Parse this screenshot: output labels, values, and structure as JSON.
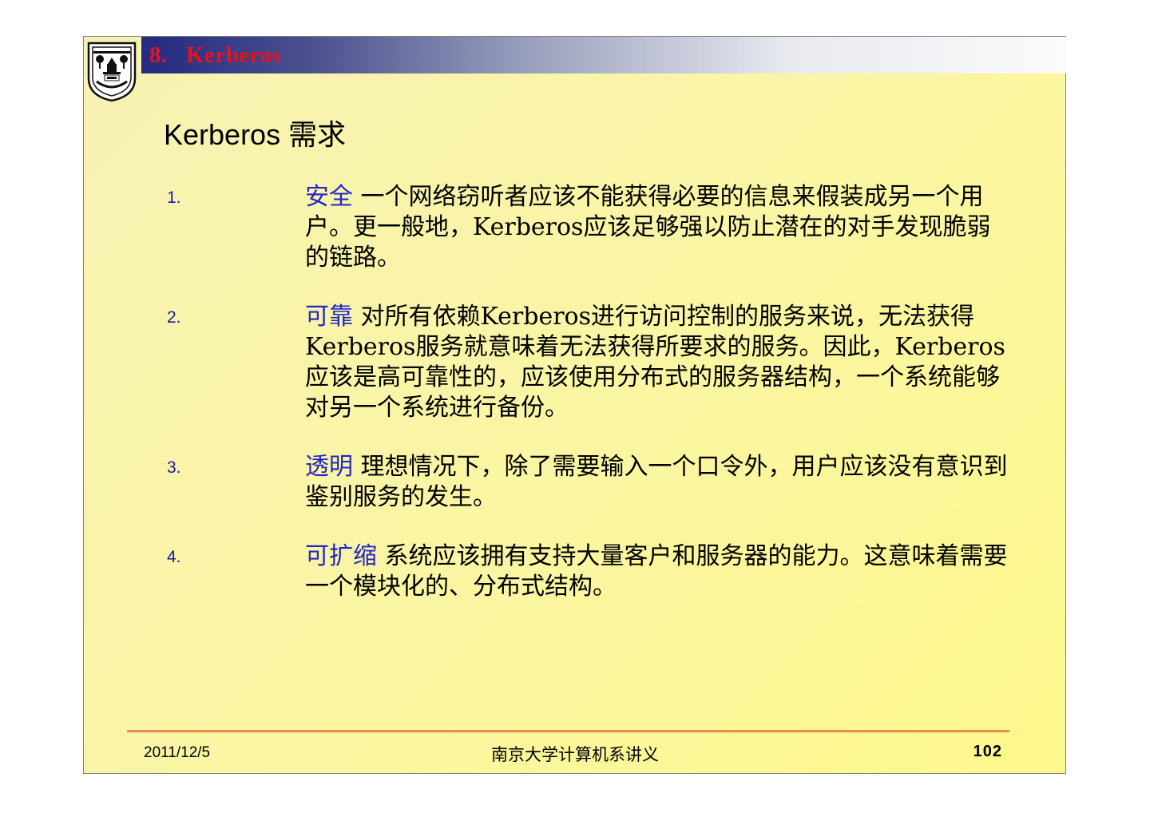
{
  "header": {
    "title": "8.   Kerberos"
  },
  "logo": {
    "icon": "university-seal-icon",
    "year": "1902",
    "text": "NANJING UNIVERSITY"
  },
  "slide": {
    "title": "Kerberos 需求"
  },
  "items": [
    {
      "number": "1.",
      "keyword": "安全",
      "text": " 一个网络窃听者应该不能获得必要的信息来假装成另一个用户。更一般地，Kerberos应该足够强以防止潜在的对手发现脆弱的链路。"
    },
    {
      "number": "2.",
      "keyword": "可靠",
      "text": " 对所有依赖Kerberos进行访问控制的服务来说，无法获得Kerberos服务就意味着无法获得所要求的服务。因此，Kerberos应该是高可靠性的，应该使用分布式的服务器结构，一个系统能够对另一个系统进行备份。"
    },
    {
      "number": "3.",
      "keyword": "透明",
      "text": " 理想情况下，除了需要输入一个口令外，用户应该没有意识到鉴别服务的发生。"
    },
    {
      "number": "4.",
      "keyword": "可扩缩",
      "text": " 系统应该拥有支持大量客户和服务器的能力。这意味着需要一个模块化的、分布式结构。"
    }
  ],
  "footer": {
    "date": "2011/12/5",
    "center": "南京大学计算机系讲义",
    "page": "102"
  },
  "colors": {
    "title_red": "#e8141b",
    "keyword_blue": "#2424c8",
    "footer_line": "#f08a4b",
    "header_dark": "#232a80"
  }
}
